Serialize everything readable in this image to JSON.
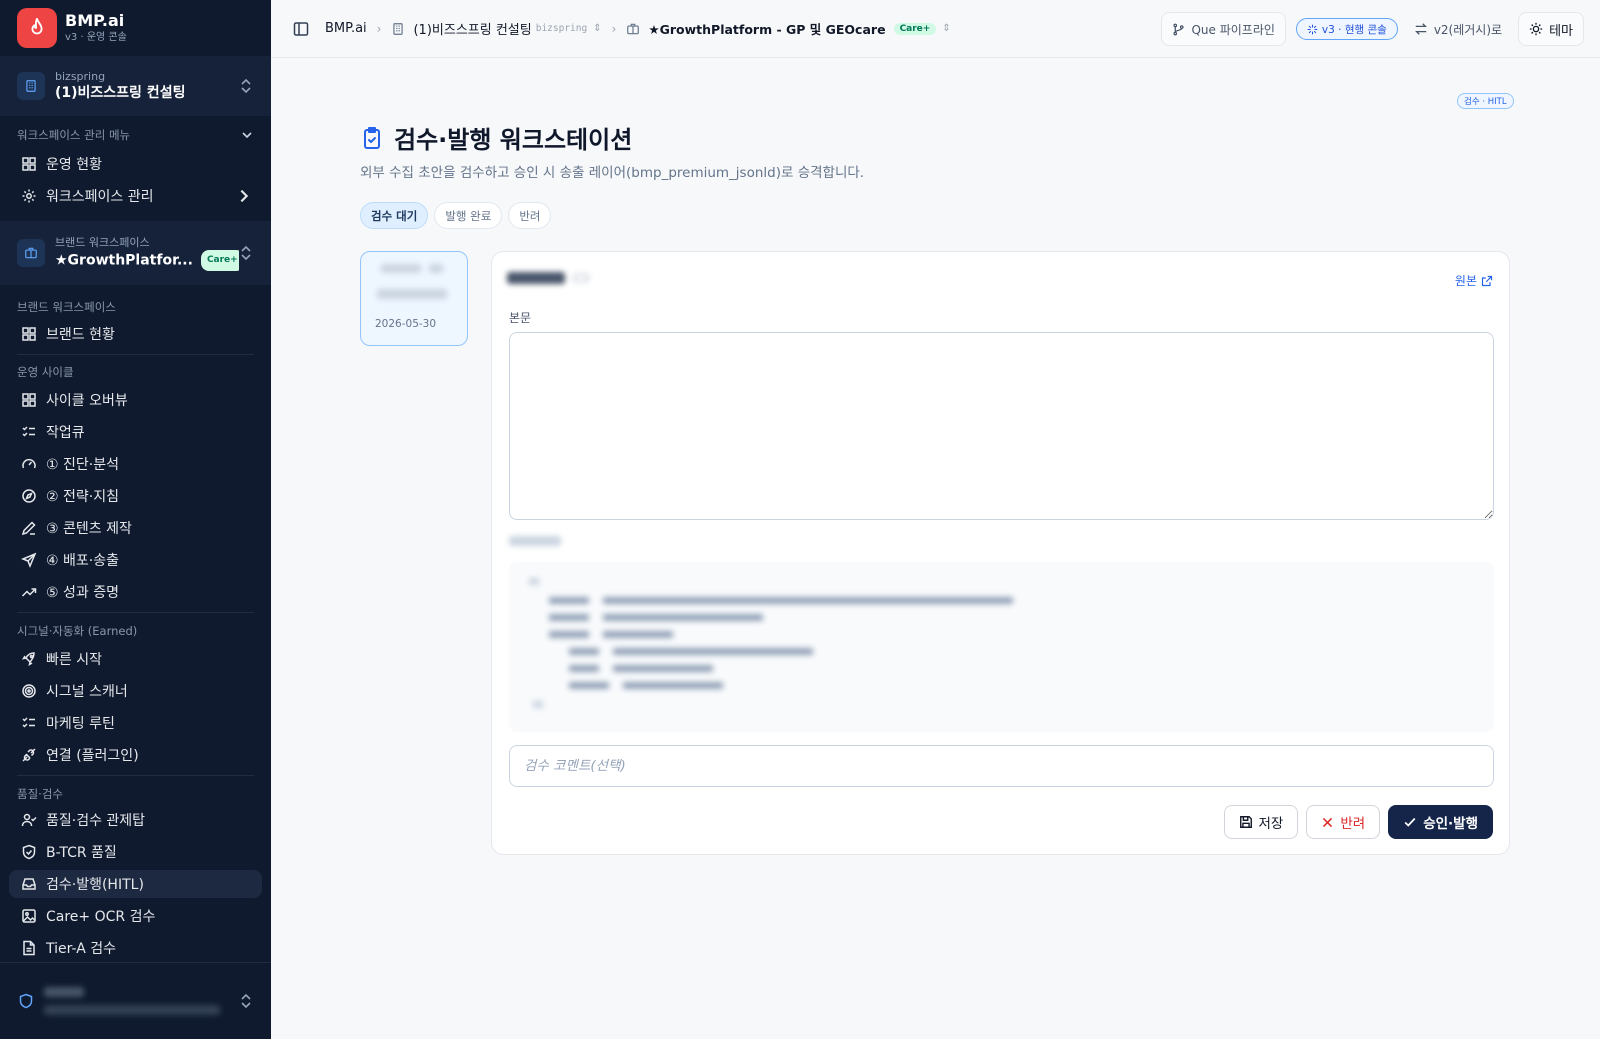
{
  "sidebar": {
    "brand": {
      "name": "BMP.ai",
      "sub": "v3 · 운영 콘솔"
    },
    "org": {
      "small": "bizspring",
      "name": "(1)비즈스프링 컨설팅"
    },
    "ws_menu": {
      "label": "워크스페이스 관리 메뉴",
      "items": [
        "운영 현황",
        "워크스페이스 관리"
      ]
    },
    "brand_ws": {
      "small": "브랜드 워크스페이스",
      "name": "★GrowthPlatfor...",
      "badge": "Care+"
    },
    "sections": {
      "brand": {
        "label": "브랜드 워크스페이스",
        "items": [
          "브랜드 현황"
        ]
      },
      "cycle": {
        "label": "운영 사이클",
        "items": [
          "사이클 오버뷰",
          "작업큐",
          "① 진단·분석",
          "② 전략·지침",
          "③ 콘텐츠 제작",
          "④ 배포·송출",
          "⑤ 성과 증명"
        ]
      },
      "signal": {
        "label": "시그널·자동화 (Earned)",
        "items": [
          "빠른 시작",
          "시그널 스캐너",
          "마케팅 루틴",
          "연결 (플러그인)"
        ]
      },
      "quality": {
        "label": "품질·검수",
        "items": [
          "품질·검수 관제탑",
          "B-TCR 품질",
          "검수·발행(HITL)",
          "Care+ OCR 검수",
          "Tier-A 검수"
        ]
      }
    }
  },
  "topbar": {
    "root": "BMP.ai",
    "org": "(1)비즈스프링 컨설팅",
    "org_slug": "bizspring",
    "workspace": "★GrowthPlatform - GP 및 GEOcare",
    "workspace_badge": "Care+",
    "pipeline": "Que 파이프라인",
    "version_pill": "v3 · 현행 콘솔",
    "legacy": "v2(레거시)로",
    "theme": "테마"
  },
  "main": {
    "tag": "검수 · HITL",
    "title": "검수·발행 워크스테이션",
    "subtitle": "외부 수집 초안을 검수하고 승인 시 송출 레이어(bmp_premium_jsonld)로 승격합니다.",
    "tabs": [
      "검수 대기",
      "발행 완료",
      "반려"
    ],
    "queue_card": {
      "date": "2026-05-30"
    },
    "detail": {
      "original_link": "원본",
      "body_label": "본문",
      "comment_placeholder": "검수 코멘트(선택)",
      "save": "저장",
      "reject": "반려",
      "approve": "승인·발행"
    }
  },
  "colors": {
    "sidebar_bg": "#0f1a2e",
    "accent": "#15254a",
    "brand_red": "#ef4444",
    "link_blue": "#2563eb",
    "reject_red": "#dc2626"
  }
}
